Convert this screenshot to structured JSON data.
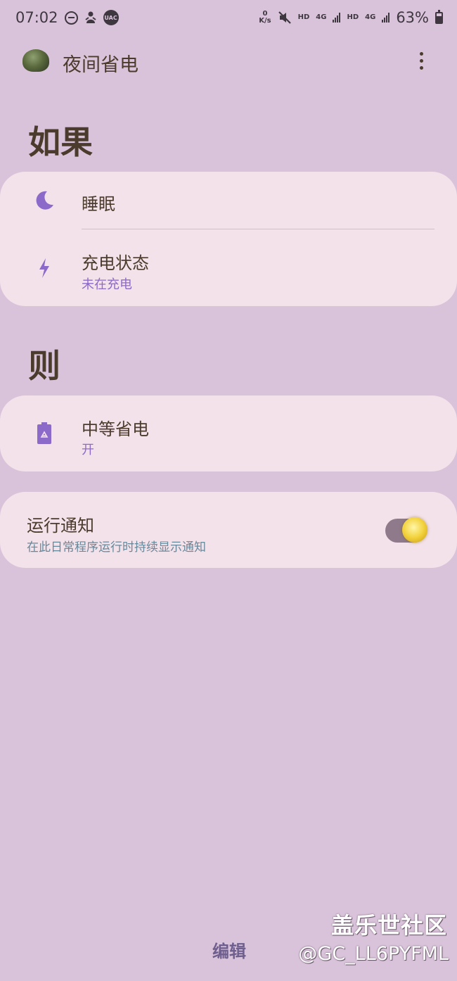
{
  "status_bar": {
    "time": "07:02",
    "speed_value": "0",
    "speed_unit": "K/s",
    "hd1": "HD",
    "net1": "4G",
    "hd2": "HD",
    "net2": "4G",
    "battery": "63%",
    "uac_label": "UAC"
  },
  "app_bar": {
    "title": "夜间省电"
  },
  "if_section": {
    "title": "如果",
    "items": [
      {
        "title": "睡眠",
        "icon": "moon-icon"
      },
      {
        "title": "充电状态",
        "subtitle": "未在充电",
        "icon": "lightning-icon"
      }
    ]
  },
  "then_section": {
    "title": "则",
    "items": [
      {
        "title": "中等省电",
        "subtitle": "开",
        "icon": "battery-saver-icon"
      }
    ]
  },
  "notification": {
    "title": "运行通知",
    "subtitle": "在此日常程序运行时持续显示通知",
    "toggle_on": true
  },
  "bottom": {
    "edit_label": "编辑"
  },
  "watermark": {
    "line1": "盖乐世社区",
    "line2": "@GC_LL6PYFML"
  },
  "colors": {
    "background": "#d9c3da",
    "card": "#f4e2ea",
    "accent": "#8c6ac9",
    "text": "#4a3b2c"
  }
}
